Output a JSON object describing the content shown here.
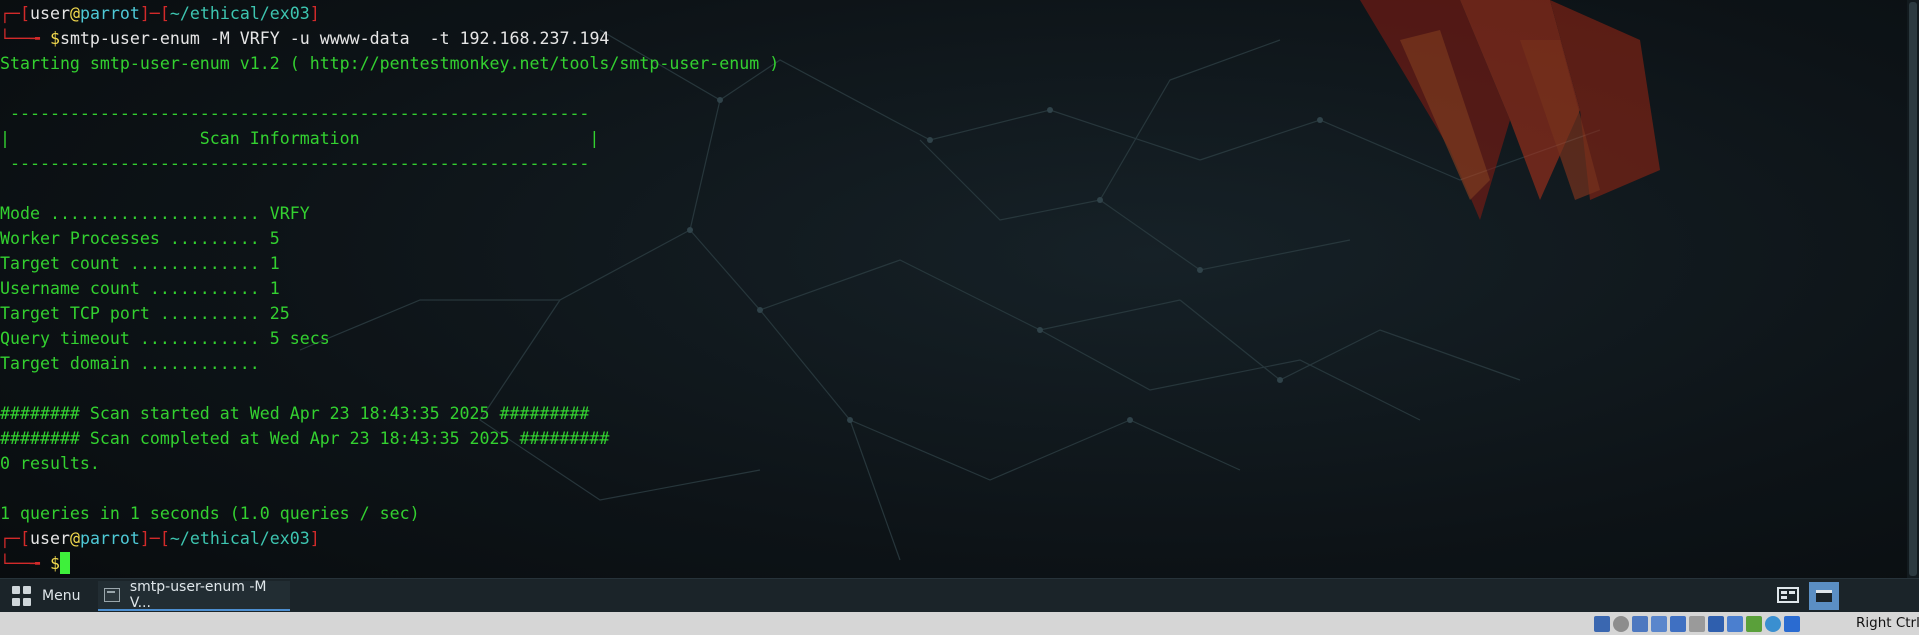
{
  "terminal": {
    "prompt1": {
      "user": "user",
      "at": "@",
      "host": "parrot",
      "path": "~/ethical/ex03",
      "dollar": "$",
      "command": "smtp-user-enum -M VRFY -u wwww-data  -t 192.168.237.194"
    },
    "output": [
      "Starting smtp-user-enum v1.2 ( http://pentestmonkey.net/tools/smtp-user-enum )",
      "",
      " ----------------------------------------------------------",
      "|                   Scan Information                       |",
      " ----------------------------------------------------------",
      "",
      "Mode ..................... VRFY",
      "Worker Processes ......... 5",
      "Target count ............. 1",
      "Username count ........... 1",
      "Target TCP port .......... 25",
      "Query timeout ............ 5 secs",
      "Target domain ............",
      "",
      "######## Scan started at Wed Apr 23 18:43:35 2025 #########",
      "######## Scan completed at Wed Apr 23 18:43:35 2025 #########",
      "0 results.",
      "",
      "1 queries in 1 seconds (1.0 queries / sec)"
    ],
    "prompt2": {
      "user": "user",
      "at": "@",
      "host": "parrot",
      "path": "~/ethical/ex03",
      "dollar": "$"
    }
  },
  "taskbar": {
    "menu_label": "Menu",
    "menu_icon": "grid-icon",
    "task_label": "smtp-user-enum -M V...",
    "task_icon": "terminal-icon"
  },
  "vm_statusbar": {
    "host_key": "Right Ctrl"
  },
  "colors": {
    "prompt_red": "#d22a2a",
    "output_green": "#33d130",
    "cursor_green": "#3ef03b",
    "taskbar_bg": "#1b2429",
    "active_accent": "#4d8fd1"
  }
}
